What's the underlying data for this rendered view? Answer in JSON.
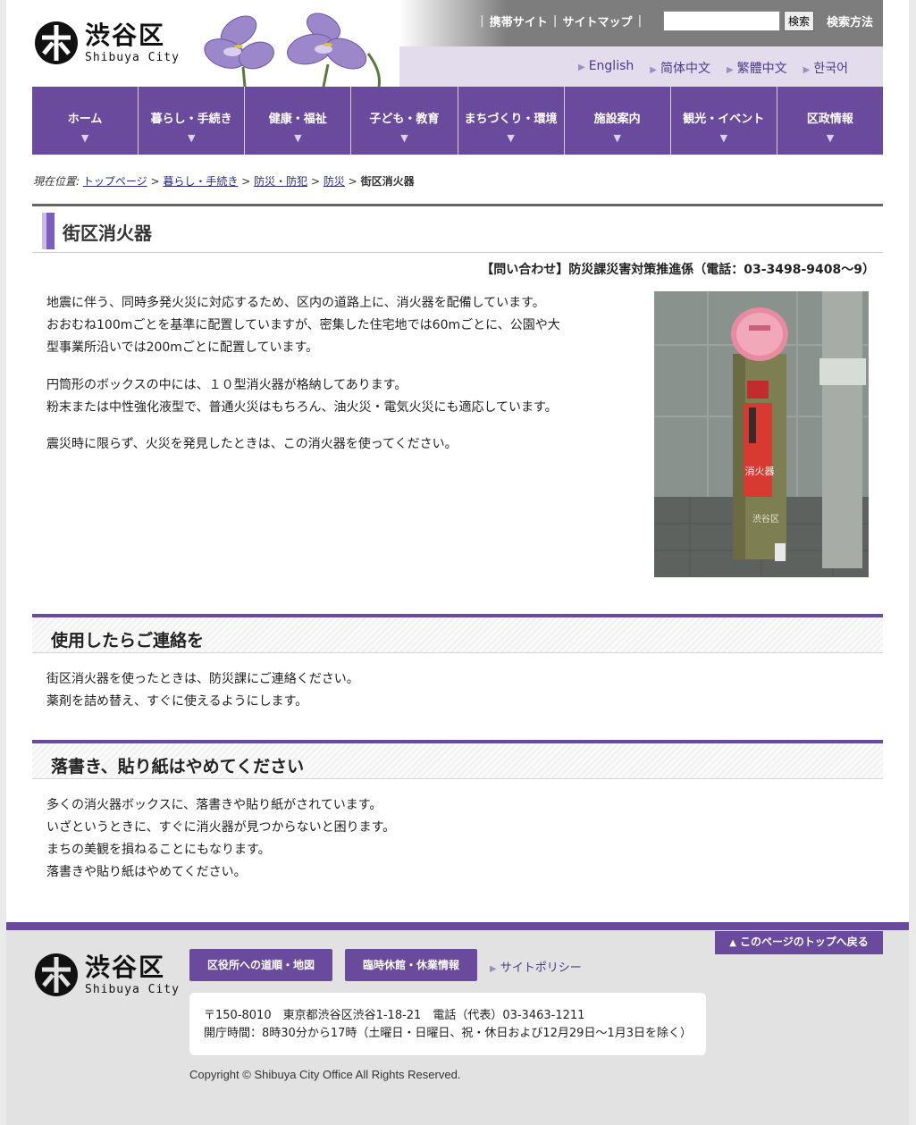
{
  "header": {
    "logo_jp": "渋谷区",
    "logo_en": "Shibuya City",
    "top_links": [
      "携帯サイト",
      "サイトマップ"
    ],
    "search_button": "検索",
    "search_help": "検索方法",
    "languages": [
      "English",
      "简体中文",
      "繁體中文",
      "한국어"
    ]
  },
  "nav": {
    "items": [
      "ホーム",
      "暮らし・手続き",
      "健康・福祉",
      "子ども・教育",
      "まちづくり・環境",
      "施設案内",
      "観光・イベント",
      "区政情報"
    ],
    "arrow": "▼"
  },
  "breadcrumb": {
    "label": "現在位置:",
    "links": [
      "トップページ",
      "暮らし・手続き",
      "防災・防犯",
      "防災"
    ],
    "separator": ">",
    "current": "街区消火器"
  },
  "page": {
    "title": "街区消火器",
    "contact": "【問い合わせ】防災課災害対策推進係（電話：03-3498-9408～9）",
    "intro": [
      [
        "地震に伴う、同時多発火災に対応するため、区内の道路上に、消火器を配備しています。",
        "おおむね100mごとを基準に配置していますが、密集した住宅地では60mごとに、公園や大",
        "型事業所沿いでは200mごとに配置しています。"
      ],
      [
        "円筒形のボックスの中には、１０型消火器が格納してあります。",
        "粉末または中性強化液型で、普通火災はもちろん、油火災・電気火災にも適応しています。"
      ],
      [
        "震災時に限らず、火災を発見したときは、この消火器を使ってください。"
      ]
    ],
    "photo_label": "消火器",
    "photo_mark": "渋谷区"
  },
  "sections": [
    {
      "heading": "使用したらご連絡を",
      "lines": [
        "街区消火器を使ったときは、防災課にご連絡ください。",
        "薬剤を詰め替え、すぐに使えるようにします。"
      ]
    },
    {
      "heading": "落書き、貼り紙はやめてください",
      "lines": [
        "多くの消火器ボックスに、落書きや貼り紙がされています。",
        "いざというときに、すぐに消火器が見つからないと困ります。",
        "まちの美観を損ねることにもなります。",
        "落書きや貼り紙はやめてください。"
      ]
    }
  ],
  "footer": {
    "page_top": "このページのトップへ戻る",
    "btn_map": "区役所への道順・地図",
    "btn_closed": "臨時休館・休業情報",
    "policy": "サイトポリシー",
    "address": "〒150-8010　東京都渋谷区渋谷1-18-21　電話（代表）03-3463-1211",
    "hours": "開庁時間：8時30分から17時（土曜日・日曜日、祝・休日および12月29日～1月3日を除く）",
    "copyright": "Copyright © Shibuya City Office All Rights Reserved."
  },
  "colors": {
    "brand_purple": "#6a4a9c",
    "lavender": "#e2dced",
    "header_gray": "#7d7d7d"
  }
}
